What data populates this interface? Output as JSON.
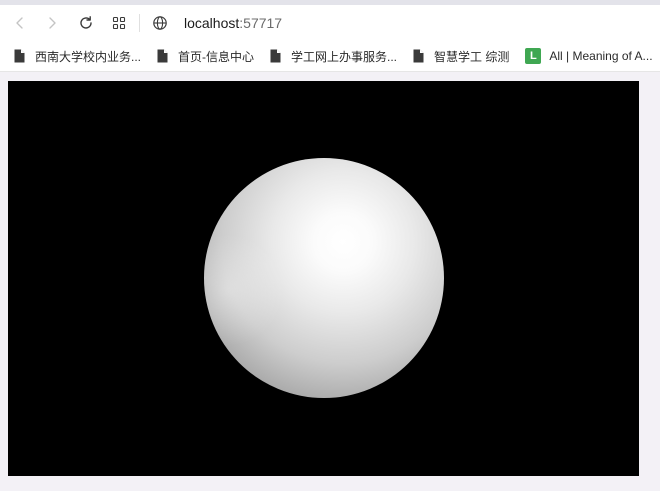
{
  "address_bar": {
    "host": "localhost",
    "port": ":57717"
  },
  "bookmarks": [
    {
      "label": "西南大学校内业务...",
      "icon": "page-icon"
    },
    {
      "label": "首页-信息中心",
      "icon": "page-icon"
    },
    {
      "label": "学工网上办事服务...",
      "icon": "page-icon"
    },
    {
      "label": "智慧学工 综测",
      "icon": "page-icon"
    },
    {
      "label": "All | Meaning of A...",
      "icon": "l-logo",
      "logo_letter": "L"
    }
  ],
  "colors": {
    "viewport_background": "#000000",
    "l_logo": "#3fa752",
    "sphere": "#e9e9e9"
  },
  "icons": {
    "back": "arrow-left-icon",
    "forward": "arrow-right-icon",
    "reload": "reload-icon",
    "apps": "grid-icon",
    "site_info": "globe-icon"
  }
}
